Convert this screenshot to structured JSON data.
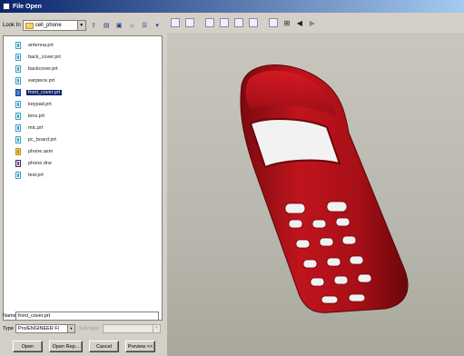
{
  "window": {
    "title": "File Open"
  },
  "look_in": {
    "label": "Look In",
    "folder": "cell_phone"
  },
  "files": [
    {
      "name": "antenna.prt",
      "kind": "part"
    },
    {
      "name": "back_cover.prt",
      "kind": "part"
    },
    {
      "name": "backcover.prt",
      "kind": "part"
    },
    {
      "name": "earpiece.prt",
      "kind": "part"
    },
    {
      "name": "front_cover.prt",
      "kind": "part",
      "selected": true
    },
    {
      "name": "keypad.prt",
      "kind": "part"
    },
    {
      "name": "lens.prt",
      "kind": "part"
    },
    {
      "name": "mic.prt",
      "kind": "part"
    },
    {
      "name": "pc_board.prt",
      "kind": "part"
    },
    {
      "name": "phone.asm",
      "kind": "assembly"
    },
    {
      "name": "phone.drw",
      "kind": "drawing"
    },
    {
      "name": "test.prt",
      "kind": "part"
    }
  ],
  "name_field": {
    "label": "Name",
    "value": "front_cover.prt"
  },
  "type_field": {
    "label": "Type",
    "value": "Pro/ENGINEER Fi",
    "subtype_label": "Sub-type"
  },
  "buttons": {
    "open": "Open",
    "open_rep": "Open Rep...",
    "cancel": "Cancel",
    "preview": "Preview <<"
  },
  "colors": {
    "model": "#b0121a",
    "titlebar": "#0a246a",
    "selection": "#0a246a"
  }
}
